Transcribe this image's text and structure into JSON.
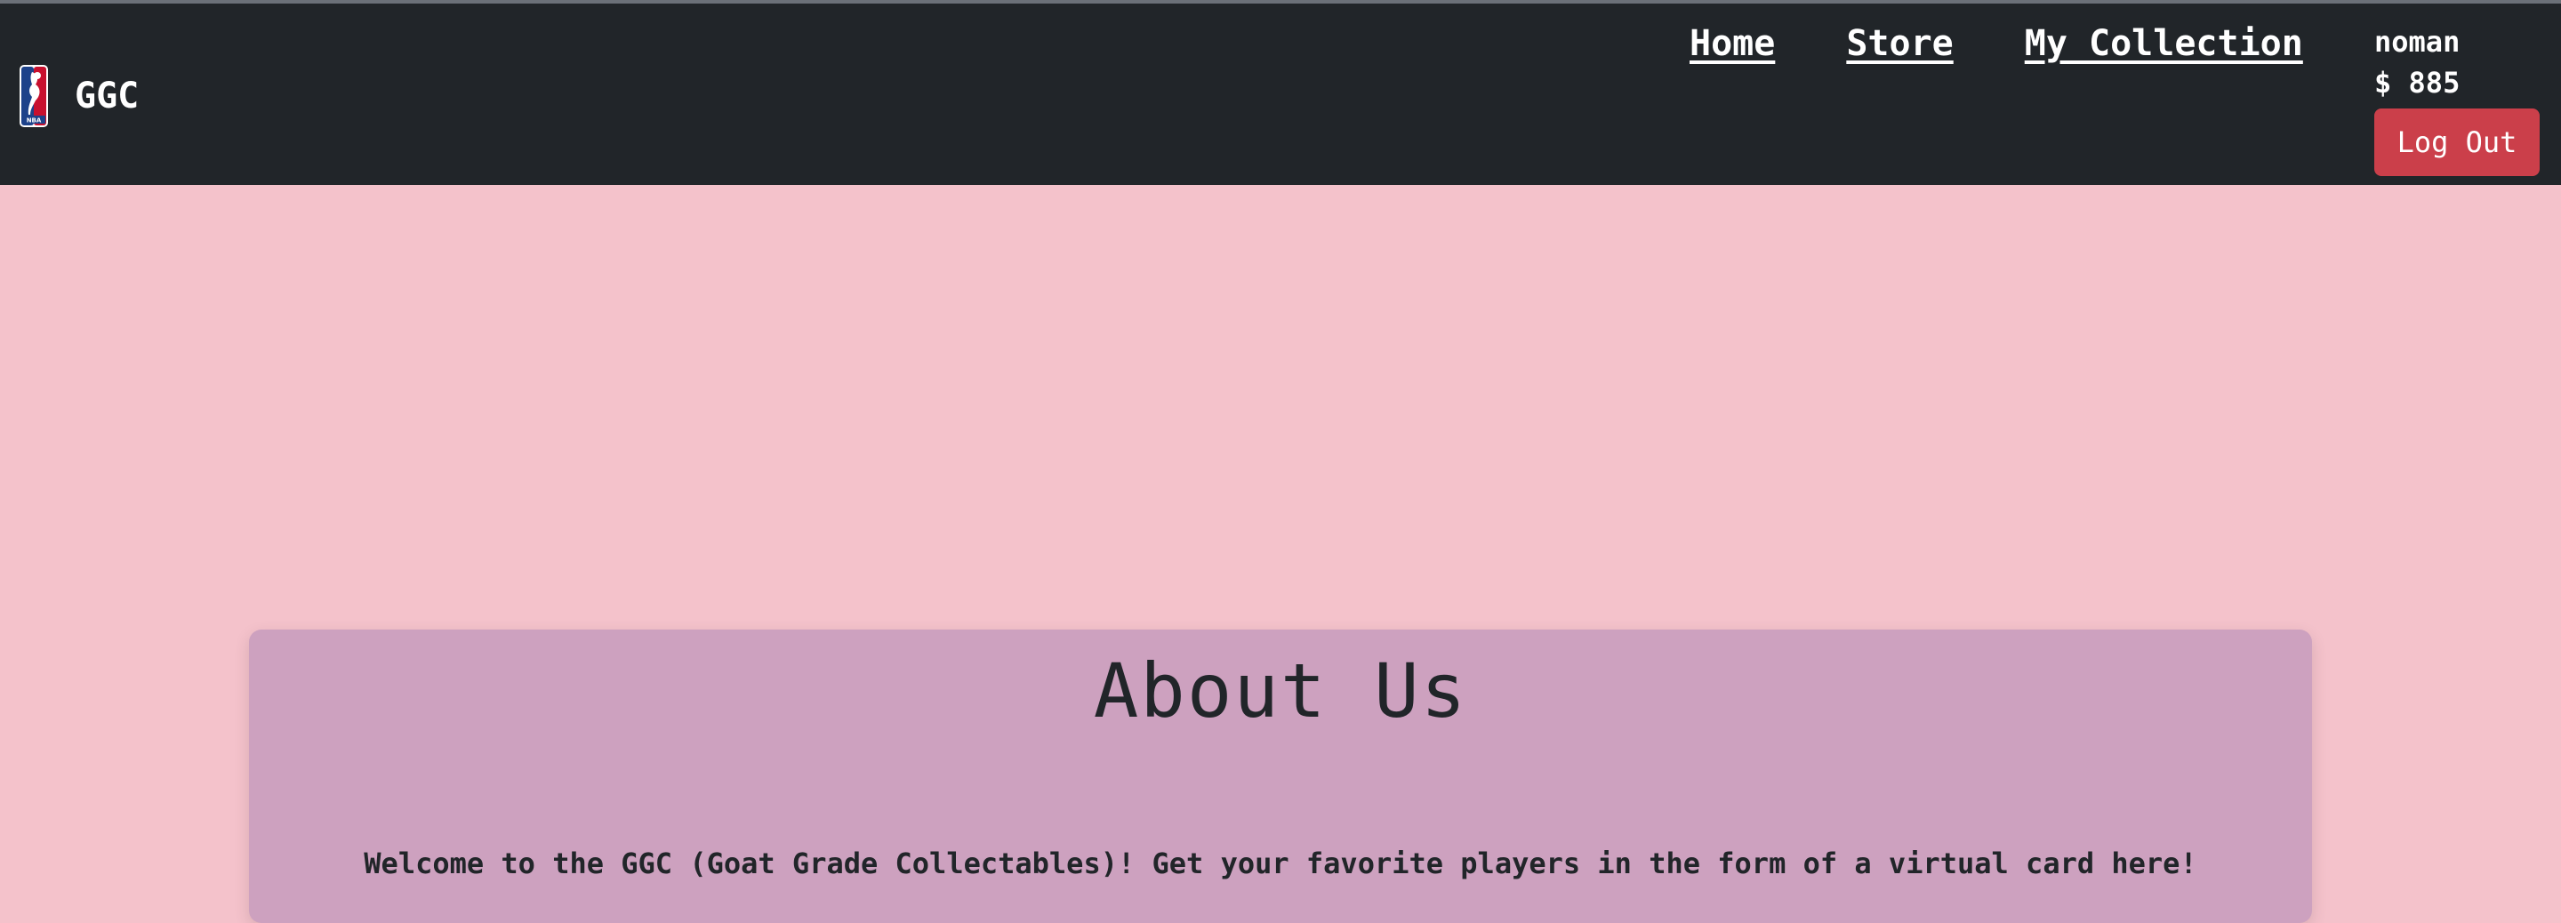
{
  "navbar": {
    "brand": "GGC",
    "logo_icon": "nba-logo-icon",
    "links": [
      {
        "label": "Home"
      },
      {
        "label": "Store"
      },
      {
        "label": "My Collection"
      }
    ],
    "user": {
      "username": "noman",
      "balance": "$ 885",
      "logout_label": "Log Out"
    }
  },
  "about": {
    "title": "About Us",
    "text": "Welcome to the GGC (Goat Grade Collectables)! Get your favorite players in the form of a virtual card here!"
  },
  "colors": {
    "navbar_bg": "#212529",
    "page_bg": "#f4c2cb",
    "card_bg": "#cda1bf",
    "logout_bg": "#cb3f4a"
  }
}
